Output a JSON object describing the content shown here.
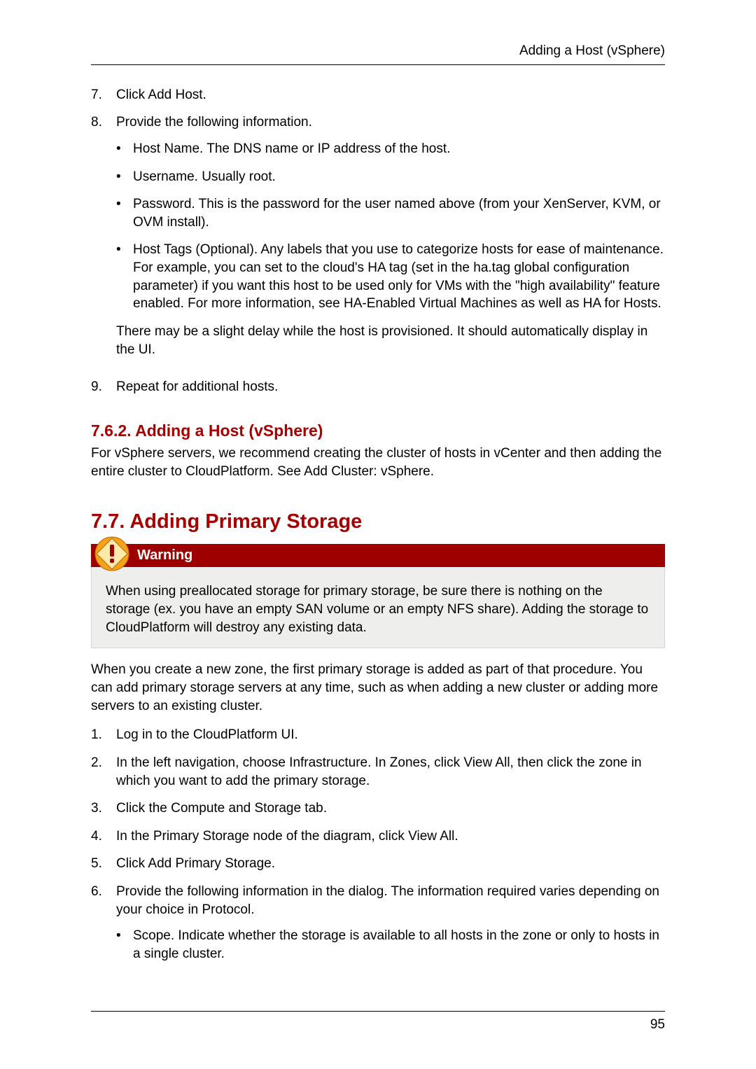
{
  "running_header": "Adding a Host (vSphere)",
  "page_number": "95",
  "host_list": {
    "item7": {
      "num": "7.",
      "text": "Click Add Host."
    },
    "item8": {
      "num": "8.",
      "intro": "Provide the following information.",
      "bullets": {
        "b1": "Host Name. The DNS name or IP address of the host.",
        "b2": "Username. Usually root.",
        "b3": "Password. This is the password for the user named above (from your XenServer, KVM, or OVM install).",
        "b4": "Host Tags (Optional). Any labels that you use to categorize hosts for ease of maintenance. For example, you can set to the cloud's HA tag (set in the ha.tag global configuration parameter) if you want this host to be used only for VMs with the \"high availability\" feature enabled. For more information, see HA-Enabled Virtual Machines as well as HA for Hosts."
      },
      "delay_note": "There may be a slight delay while the host is provisioned. It should automatically display in the UI."
    },
    "item9": {
      "num": "9.",
      "text": "Repeat for additional hosts."
    }
  },
  "sec_762": {
    "title": "7.6.2. Adding a Host (vSphere)",
    "body": "For vSphere servers, we recommend creating the cluster of hosts in vCenter and then adding the entire cluster to CloudPlatform. See Add Cluster: vSphere."
  },
  "sec_77": {
    "title": "7.7. Adding Primary Storage",
    "warning_title": "Warning",
    "warning_body": "When using preallocated storage for primary storage, be sure there is nothing on the storage (ex. you have an empty SAN volume or an empty NFS share). Adding the storage to CloudPlatform will destroy any existing data.",
    "intro": "When you create a new zone, the first primary storage is added as part of that procedure. You can add primary storage servers at any time, such as when adding a new cluster or adding more servers to an existing cluster.",
    "steps": {
      "s1": {
        "num": "1.",
        "text": "Log in to the CloudPlatform UI."
      },
      "s2": {
        "num": "2.",
        "text": "In the left navigation, choose Infrastructure. In Zones, click View All, then click the zone in which you want to add the primary storage."
      },
      "s3": {
        "num": "3.",
        "text": "Click the Compute and Storage tab."
      },
      "s4": {
        "num": "4.",
        "text": "In the Primary Storage node of the diagram, click View All."
      },
      "s5": {
        "num": "5.",
        "text": "Click Add Primary Storage."
      },
      "s6": {
        "num": "6.",
        "text": "Provide the following information in the dialog. The information required varies depending on your choice in Protocol.",
        "bullet": "Scope. Indicate whether the storage is available to all hosts in the zone or only to hosts in a single cluster."
      }
    }
  }
}
